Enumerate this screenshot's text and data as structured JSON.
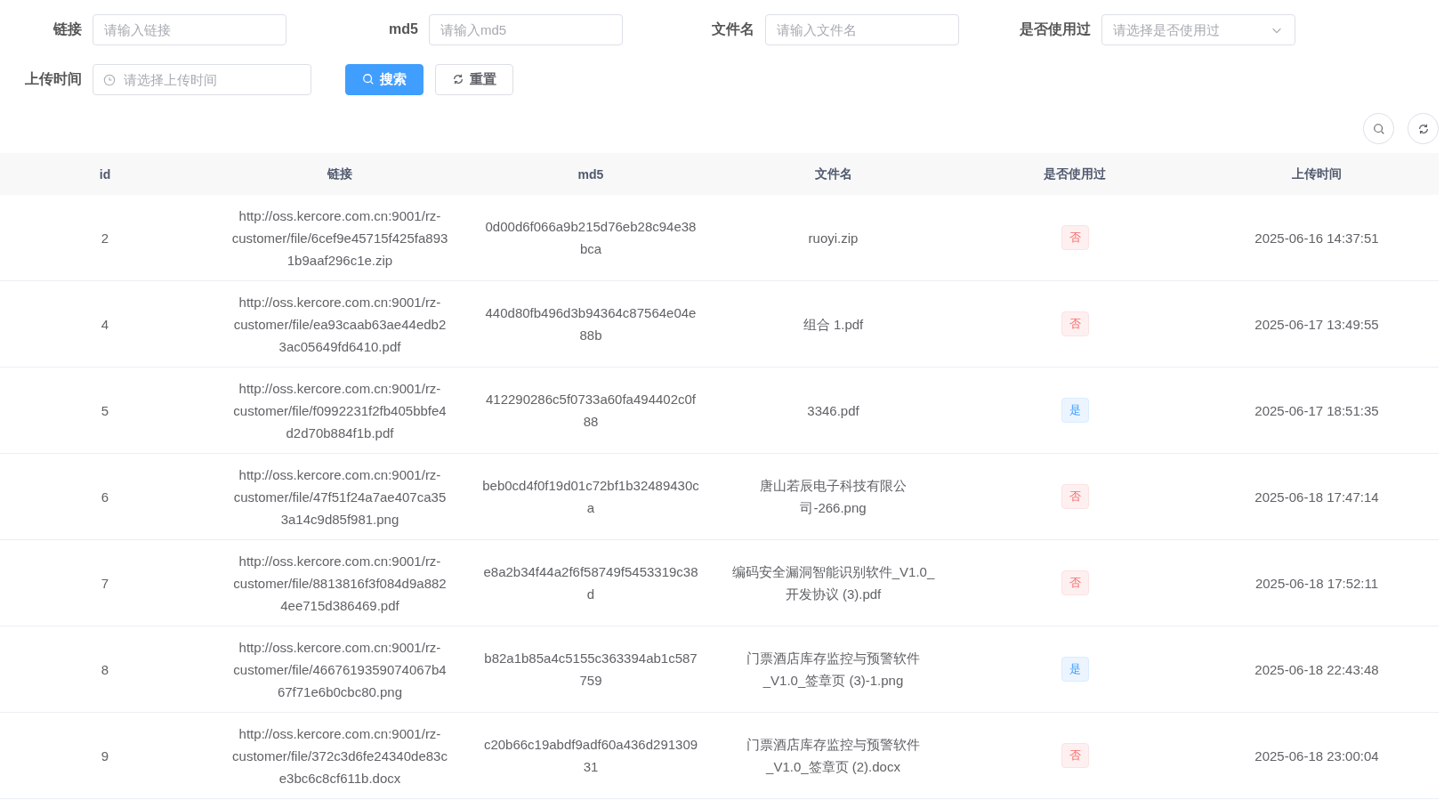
{
  "filters": [
    {
      "label": "链接",
      "kind": "input",
      "placeholder": "请输入链接"
    },
    {
      "label": "md5",
      "kind": "input",
      "placeholder": "请输入md5"
    },
    {
      "label": "文件名",
      "kind": "input",
      "placeholder": "请输入文件名"
    },
    {
      "label": "是否使用过",
      "kind": "select",
      "placeholder": "请选择是否使用过"
    },
    {
      "label": "上传时间",
      "kind": "date",
      "placeholder": "请选择上传时间"
    }
  ],
  "actions": [
    {
      "label": "搜索",
      "kind": "primary"
    },
    {
      "label": "重置",
      "kind": "default"
    }
  ],
  "table": {
    "columns": [
      "id",
      "链接",
      "md5",
      "文件名",
      "是否使用过",
      "上传时间"
    ],
    "rows": [
      {
        "id": "2",
        "link": "http://oss.kercore.com.cn:9001/rz-customer/file/6cef9e45715f425fa8931b9aaf296c1e.zip",
        "md5": "0d00d6f066a9b215d76eb28c94e38bca",
        "filename": "ruoyi.zip",
        "used": false,
        "used_label": "否",
        "time": "2025-06-16 14:37:51"
      },
      {
        "id": "4",
        "link": "http://oss.kercore.com.cn:9001/rz-customer/file/ea93caab63ae44edb23ac05649fd6410.pdf",
        "md5": "440d80fb496d3b94364c87564e04e88b",
        "filename": "组合 1.pdf",
        "used": false,
        "used_label": "否",
        "time": "2025-06-17 13:49:55"
      },
      {
        "id": "5",
        "link": "http://oss.kercore.com.cn:9001/rz-customer/file/f0992231f2fb405bbfe4d2d70b884f1b.pdf",
        "md5": "412290286c5f0733a60fa494402c0f88",
        "filename": "3346.pdf",
        "used": true,
        "used_label": "是",
        "time": "2025-06-17 18:51:35"
      },
      {
        "id": "6",
        "link": "http://oss.kercore.com.cn:9001/rz-customer/file/47f51f24a7ae407ca353a14c9d85f981.png",
        "md5": "beb0cd4f0f19d01c72bf1b32489430ca",
        "filename": "唐山若辰电子科技有限公司-266.png",
        "used": false,
        "used_label": "否",
        "time": "2025-06-18 17:47:14"
      },
      {
        "id": "7",
        "link": "http://oss.kercore.com.cn:9001/rz-customer/file/8813816f3f084d9a8824ee715d386469.pdf",
        "md5": "e8a2b34f44a2f6f58749f5453319c38d",
        "filename": "编码安全漏洞智能识别软件_V1.0_开发协议 (3).pdf",
        "used": false,
        "used_label": "否",
        "time": "2025-06-18 17:52:11"
      },
      {
        "id": "8",
        "link": "http://oss.kercore.com.cn:9001/rz-customer/file/4667619359074067b467f71e6b0cbc80.png",
        "md5": "b82a1b85a4c5155c363394ab1c587759",
        "filename": "门票酒店库存监控与预警软件_V1.0_签章页 (3)-1.png",
        "used": true,
        "used_label": "是",
        "time": "2025-06-18 22:43:48"
      },
      {
        "id": "9",
        "link": "http://oss.kercore.com.cn:9001/rz-customer/file/372c3d6fe24340de83ce3bc6c8cf611b.docx",
        "md5": "c20b66c19abdf9adf60a436d29130931",
        "filename": "门票酒店库存监控与预警软件_V1.0_签章页 (2).docx",
        "used": false,
        "used_label": "否",
        "time": "2025-06-18 23:00:04"
      }
    ]
  }
}
